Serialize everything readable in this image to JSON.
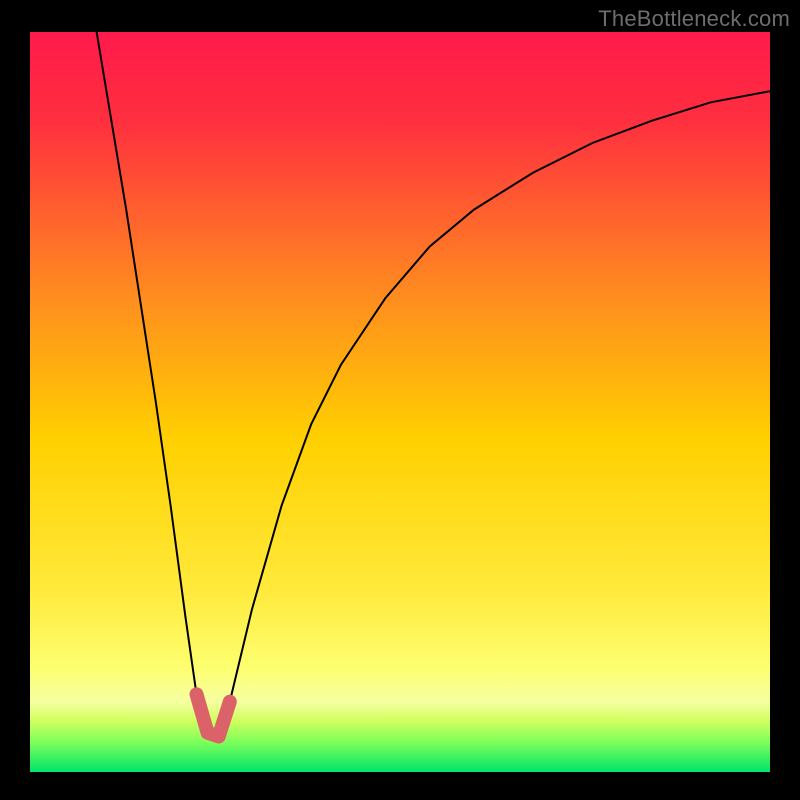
{
  "watermark": "TheBottleneck.com",
  "chart_data": {
    "type": "line",
    "title": "",
    "xlabel": "",
    "ylabel": "",
    "xlim": [
      0,
      100
    ],
    "ylim": [
      0,
      100
    ],
    "series": [
      {
        "name": "bottleneck-curve",
        "x": [
          9,
          11,
          13,
          15,
          17,
          19,
          21,
          22.5,
          24,
          25.5,
          27,
          30,
          34,
          38,
          42,
          48,
          54,
          60,
          68,
          76,
          84,
          92,
          100
        ],
        "values": [
          100,
          88,
          76,
          63,
          50,
          36,
          21,
          10.5,
          5.3,
          4.8,
          9.5,
          22,
          36,
          47,
          55,
          64,
          71,
          76,
          81,
          85,
          88,
          90.5,
          92
        ]
      }
    ],
    "highlight_zone": {
      "name": "no-bottleneck-band",
      "x_range": [
        22,
        27
      ],
      "color": "#da6268"
    },
    "background_gradient": {
      "top": "#ff1a4b",
      "mid": "#ffd000",
      "green_band_top": "#d3ff60",
      "bottom": "#00e46a"
    }
  }
}
